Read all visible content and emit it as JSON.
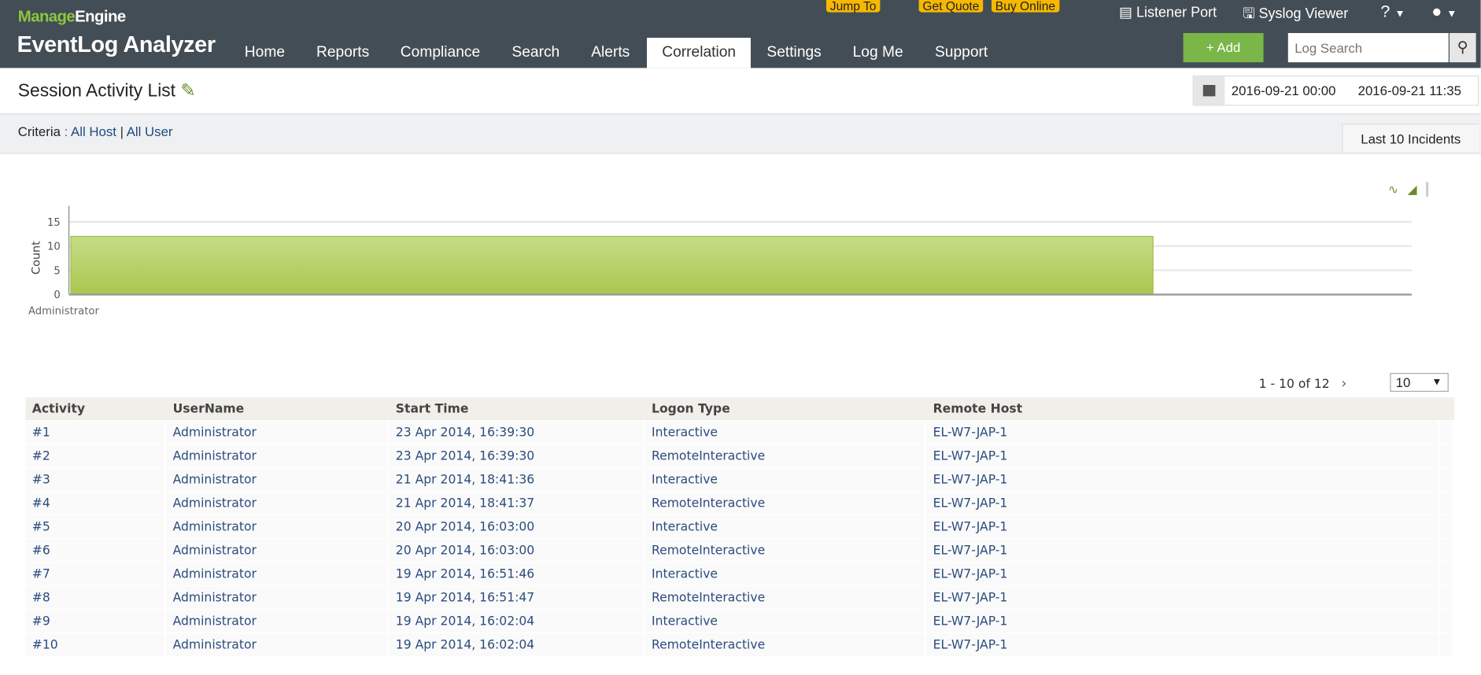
{
  "header": {
    "brand_prefix": "Manage",
    "brand_suffix": "Engine",
    "product": "EventLog Analyzer",
    "nav": [
      "Home",
      "Reports",
      "Compliance",
      "Search",
      "Alerts",
      "Correlation",
      "Settings",
      "Log Me",
      "Support"
    ],
    "active_nav": "Correlation",
    "top_buttons": [
      "Jump To",
      "Get Quote",
      "Buy Online"
    ],
    "listener_port": "Listener Port",
    "syslog_viewer": "Syslog Viewer",
    "help": "?",
    "add_label": "+ Add",
    "search_placeholder": "Log Search"
  },
  "page": {
    "title": "Session Activity List",
    "date_from": "2016-09-21 00:00",
    "date_to": "2016-09-21 11:35",
    "criteria_label": "Criteria",
    "criteria_sep": ":",
    "criteria": [
      "All Host",
      "All User"
    ],
    "last_incidents": "Last 10 Incidents"
  },
  "chart_data": {
    "type": "bar",
    "categories": [
      "Administrator"
    ],
    "values": [
      12
    ],
    "ylabel": "Count",
    "xlabel": "",
    "ylim": [
      0,
      15
    ],
    "yticks": [
      0,
      5,
      10,
      15
    ],
    "color": "#a9cc5a",
    "grid": true
  },
  "table": {
    "pagination": "1 - 10 of 12",
    "page_size": "10",
    "columns": [
      "Activity",
      "UserName",
      "Start Time",
      "Logon Type",
      "Remote Host"
    ],
    "rows": [
      [
        "#1",
        "Administrator",
        "23 Apr 2014, 16:39:30",
        "Interactive",
        "EL-W7-JAP-1"
      ],
      [
        "#2",
        "Administrator",
        "23 Apr 2014, 16:39:30",
        "RemoteInteractive",
        "EL-W7-JAP-1"
      ],
      [
        "#3",
        "Administrator",
        "21 Apr 2014, 18:41:36",
        "Interactive",
        "EL-W7-JAP-1"
      ],
      [
        "#4",
        "Administrator",
        "21 Apr 2014, 18:41:37",
        "RemoteInteractive",
        "EL-W7-JAP-1"
      ],
      [
        "#5",
        "Administrator",
        "20 Apr 2014, 16:03:00",
        "Interactive",
        "EL-W7-JAP-1"
      ],
      [
        "#6",
        "Administrator",
        "20 Apr 2014, 16:03:00",
        "RemoteInteractive",
        "EL-W7-JAP-1"
      ],
      [
        "#7",
        "Administrator",
        "19 Apr 2014, 16:51:46",
        "Interactive",
        "EL-W7-JAP-1"
      ],
      [
        "#8",
        "Administrator",
        "19 Apr 2014, 16:51:47",
        "RemoteInteractive",
        "EL-W7-JAP-1"
      ],
      [
        "#9",
        "Administrator",
        "19 Apr 2014, 16:02:04",
        "Interactive",
        "EL-W7-JAP-1"
      ],
      [
        "#10",
        "Administrator",
        "19 Apr 2014, 16:02:04",
        "RemoteInteractive",
        "EL-W7-JAP-1"
      ]
    ]
  }
}
